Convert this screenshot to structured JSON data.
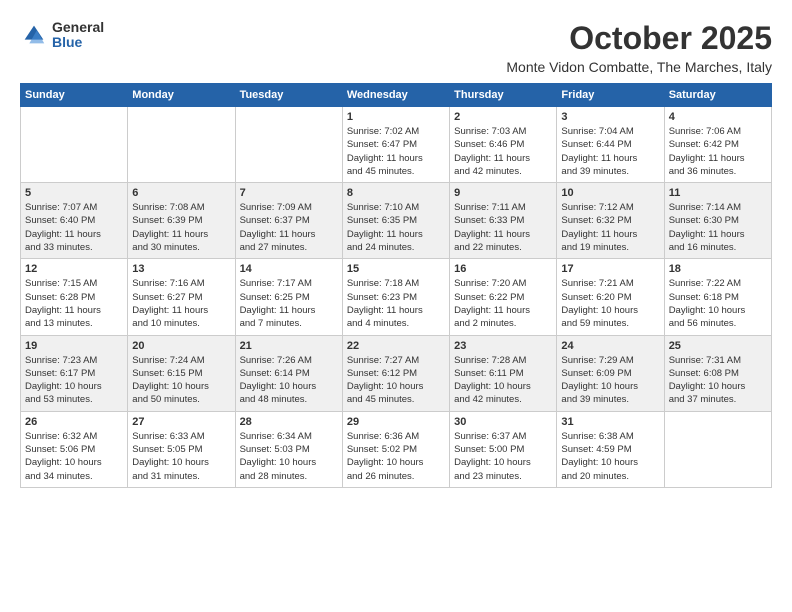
{
  "header": {
    "logo_general": "General",
    "logo_blue": "Blue",
    "title": "October 2025",
    "subtitle": "Monte Vidon Combatte, The Marches, Italy"
  },
  "weekdays": [
    "Sunday",
    "Monday",
    "Tuesday",
    "Wednesday",
    "Thursday",
    "Friday",
    "Saturday"
  ],
  "weeks": [
    {
      "shaded": false,
      "days": [
        {
          "num": "",
          "content": ""
        },
        {
          "num": "",
          "content": ""
        },
        {
          "num": "",
          "content": ""
        },
        {
          "num": "1",
          "content": "Sunrise: 7:02 AM\nSunset: 6:47 PM\nDaylight: 11 hours\nand 45 minutes."
        },
        {
          "num": "2",
          "content": "Sunrise: 7:03 AM\nSunset: 6:46 PM\nDaylight: 11 hours\nand 42 minutes."
        },
        {
          "num": "3",
          "content": "Sunrise: 7:04 AM\nSunset: 6:44 PM\nDaylight: 11 hours\nand 39 minutes."
        },
        {
          "num": "4",
          "content": "Sunrise: 7:06 AM\nSunset: 6:42 PM\nDaylight: 11 hours\nand 36 minutes."
        }
      ]
    },
    {
      "shaded": true,
      "days": [
        {
          "num": "5",
          "content": "Sunrise: 7:07 AM\nSunset: 6:40 PM\nDaylight: 11 hours\nand 33 minutes."
        },
        {
          "num": "6",
          "content": "Sunrise: 7:08 AM\nSunset: 6:39 PM\nDaylight: 11 hours\nand 30 minutes."
        },
        {
          "num": "7",
          "content": "Sunrise: 7:09 AM\nSunset: 6:37 PM\nDaylight: 11 hours\nand 27 minutes."
        },
        {
          "num": "8",
          "content": "Sunrise: 7:10 AM\nSunset: 6:35 PM\nDaylight: 11 hours\nand 24 minutes."
        },
        {
          "num": "9",
          "content": "Sunrise: 7:11 AM\nSunset: 6:33 PM\nDaylight: 11 hours\nand 22 minutes."
        },
        {
          "num": "10",
          "content": "Sunrise: 7:12 AM\nSunset: 6:32 PM\nDaylight: 11 hours\nand 19 minutes."
        },
        {
          "num": "11",
          "content": "Sunrise: 7:14 AM\nSunset: 6:30 PM\nDaylight: 11 hours\nand 16 minutes."
        }
      ]
    },
    {
      "shaded": false,
      "days": [
        {
          "num": "12",
          "content": "Sunrise: 7:15 AM\nSunset: 6:28 PM\nDaylight: 11 hours\nand 13 minutes."
        },
        {
          "num": "13",
          "content": "Sunrise: 7:16 AM\nSunset: 6:27 PM\nDaylight: 11 hours\nand 10 minutes."
        },
        {
          "num": "14",
          "content": "Sunrise: 7:17 AM\nSunset: 6:25 PM\nDaylight: 11 hours\nand 7 minutes."
        },
        {
          "num": "15",
          "content": "Sunrise: 7:18 AM\nSunset: 6:23 PM\nDaylight: 11 hours\nand 4 minutes."
        },
        {
          "num": "16",
          "content": "Sunrise: 7:20 AM\nSunset: 6:22 PM\nDaylight: 11 hours\nand 2 minutes."
        },
        {
          "num": "17",
          "content": "Sunrise: 7:21 AM\nSunset: 6:20 PM\nDaylight: 10 hours\nand 59 minutes."
        },
        {
          "num": "18",
          "content": "Sunrise: 7:22 AM\nSunset: 6:18 PM\nDaylight: 10 hours\nand 56 minutes."
        }
      ]
    },
    {
      "shaded": true,
      "days": [
        {
          "num": "19",
          "content": "Sunrise: 7:23 AM\nSunset: 6:17 PM\nDaylight: 10 hours\nand 53 minutes."
        },
        {
          "num": "20",
          "content": "Sunrise: 7:24 AM\nSunset: 6:15 PM\nDaylight: 10 hours\nand 50 minutes."
        },
        {
          "num": "21",
          "content": "Sunrise: 7:26 AM\nSunset: 6:14 PM\nDaylight: 10 hours\nand 48 minutes."
        },
        {
          "num": "22",
          "content": "Sunrise: 7:27 AM\nSunset: 6:12 PM\nDaylight: 10 hours\nand 45 minutes."
        },
        {
          "num": "23",
          "content": "Sunrise: 7:28 AM\nSunset: 6:11 PM\nDaylight: 10 hours\nand 42 minutes."
        },
        {
          "num": "24",
          "content": "Sunrise: 7:29 AM\nSunset: 6:09 PM\nDaylight: 10 hours\nand 39 minutes."
        },
        {
          "num": "25",
          "content": "Sunrise: 7:31 AM\nSunset: 6:08 PM\nDaylight: 10 hours\nand 37 minutes."
        }
      ]
    },
    {
      "shaded": false,
      "days": [
        {
          "num": "26",
          "content": "Sunrise: 6:32 AM\nSunset: 5:06 PM\nDaylight: 10 hours\nand 34 minutes."
        },
        {
          "num": "27",
          "content": "Sunrise: 6:33 AM\nSunset: 5:05 PM\nDaylight: 10 hours\nand 31 minutes."
        },
        {
          "num": "28",
          "content": "Sunrise: 6:34 AM\nSunset: 5:03 PM\nDaylight: 10 hours\nand 28 minutes."
        },
        {
          "num": "29",
          "content": "Sunrise: 6:36 AM\nSunset: 5:02 PM\nDaylight: 10 hours\nand 26 minutes."
        },
        {
          "num": "30",
          "content": "Sunrise: 6:37 AM\nSunset: 5:00 PM\nDaylight: 10 hours\nand 23 minutes."
        },
        {
          "num": "31",
          "content": "Sunrise: 6:38 AM\nSunset: 4:59 PM\nDaylight: 10 hours\nand 20 minutes."
        },
        {
          "num": "",
          "content": ""
        }
      ]
    }
  ]
}
